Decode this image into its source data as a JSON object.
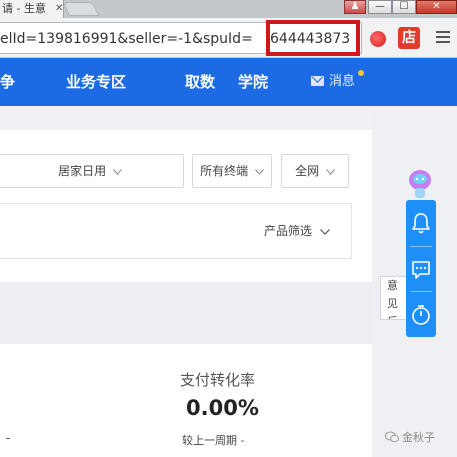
{
  "browser": {
    "tab_title": "请 - 生意",
    "tab_close": "✕",
    "window_buttons": {
      "user": "♟",
      "minimize": "—",
      "maximize": "☐",
      "close": "✕"
    },
    "url_text": "elId=139816991&seller=-1&spuId=",
    "url_highlight": "644443873",
    "ext_red_label": "",
    "ext_box_label": "店"
  },
  "header": {
    "nav_items": [
      "争",
      "业务专区",
      "取数",
      "学院"
    ],
    "message_label": "消息"
  },
  "filters": {
    "category": "居家日用",
    "terminal": "所有终端",
    "network": "全网",
    "product_filter": "产品筛选"
  },
  "stats": {
    "label": "支付转化率",
    "value": "0.00%",
    "compare": "较上一周期 -",
    "left_dash": "-"
  },
  "right_rail": {
    "feedback_line1": "意见",
    "feedback_line2": "反馈"
  },
  "watermark": "金秋子",
  "colors": {
    "brand_blue": "#1c6ae4",
    "float_blue": "#1e8ff7",
    "highlight_red": "#d01818"
  }
}
